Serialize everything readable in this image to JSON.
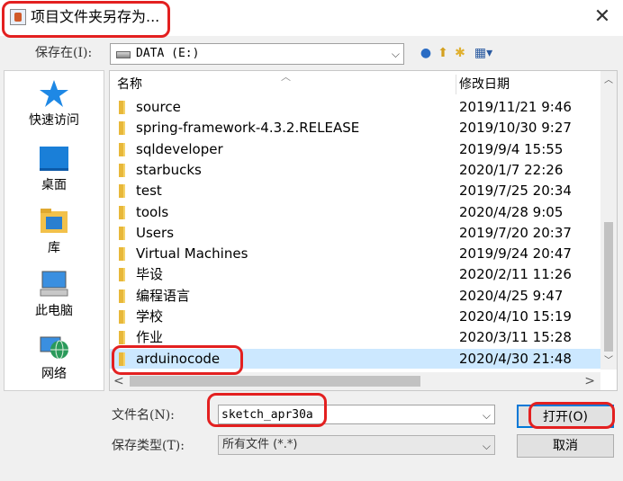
{
  "window": {
    "title": "项目文件夹另存为..."
  },
  "lookin": {
    "label": "保存在(I):",
    "value": "DATA (E:)"
  },
  "places": [
    {
      "label": "快速访问",
      "icon": "star-icon"
    },
    {
      "label": "桌面",
      "icon": "desktop-icon"
    },
    {
      "label": "库",
      "icon": "library-icon"
    },
    {
      "label": "此电脑",
      "icon": "computer-icon"
    },
    {
      "label": "网络",
      "icon": "network-icon"
    }
  ],
  "table": {
    "col_name": "名称",
    "col_date": "修改日期",
    "rows": [
      {
        "name": "source",
        "date": "2019/11/21 9:46"
      },
      {
        "name": "spring-framework-4.3.2.RELEASE",
        "date": "2019/10/30 9:27"
      },
      {
        "name": "sqldeveloper",
        "date": "2019/9/4 15:55"
      },
      {
        "name": "starbucks",
        "date": "2020/1/7 22:26"
      },
      {
        "name": "test",
        "date": "2019/7/25 20:34"
      },
      {
        "name": "tools",
        "date": "2020/4/28 9:05"
      },
      {
        "name": "Users",
        "date": "2019/7/20 20:37"
      },
      {
        "name": "Virtual Machines",
        "date": "2019/9/24 20:47"
      },
      {
        "name": "毕设",
        "date": "2020/2/11 11:26"
      },
      {
        "name": "编程语言",
        "date": "2020/4/25 9:47"
      },
      {
        "name": "学校",
        "date": "2020/4/10 15:19"
      },
      {
        "name": "作业",
        "date": "2020/3/11 15:28"
      },
      {
        "name": "arduinocode",
        "date": "2020/4/30 21:48"
      }
    ]
  },
  "filename": {
    "label": "文件名(N):",
    "value": "sketch_apr30a"
  },
  "filetype": {
    "label": "保存类型(T):",
    "value": "所有文件 (*.*)"
  },
  "buttons": {
    "open": "打开(O)",
    "cancel": "取消"
  }
}
